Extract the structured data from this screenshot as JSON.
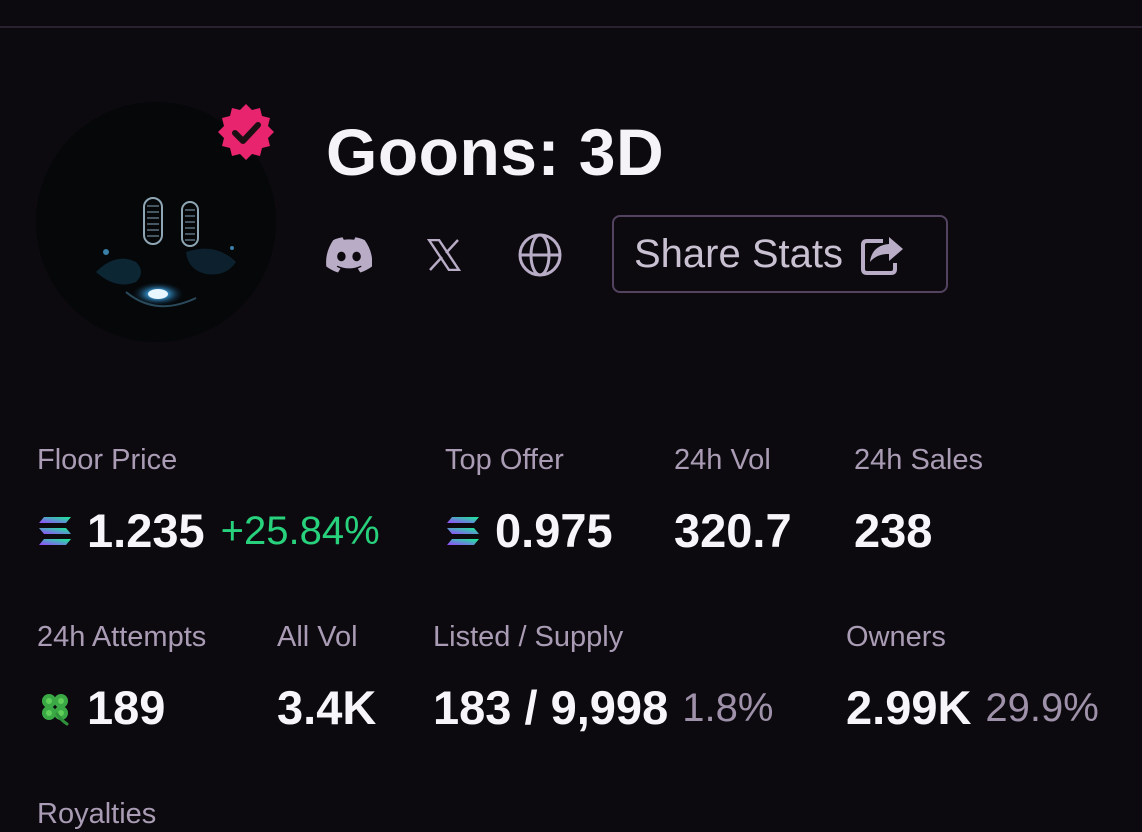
{
  "collection": {
    "name": "Goons: 3D",
    "verified": true
  },
  "links": {
    "discord_icon": "discord-icon",
    "x_icon": "x-icon",
    "website_icon": "globe-icon"
  },
  "share": {
    "label": "Share Stats",
    "icon": "share-icon"
  },
  "stats": {
    "floor_price": {
      "label": "Floor Price",
      "value": "1.235",
      "change": "+25.84%"
    },
    "top_offer": {
      "label": "Top Offer",
      "value": "0.975"
    },
    "vol_24h": {
      "label": "24h Vol",
      "value": "320.7"
    },
    "sales_24h": {
      "label": "24h Sales",
      "value": "238"
    },
    "attempts_24h": {
      "label": "24h Attempts",
      "value": "189"
    },
    "all_vol": {
      "label": "All Vol",
      "value": "3.4K"
    },
    "listed_supply": {
      "label": "Listed / Supply",
      "value": "183 / 9,998",
      "percent": "1.8%"
    },
    "owners": {
      "label": "Owners",
      "value": "2.99K",
      "percent": "29.9%"
    },
    "royalties": {
      "label": "Royalties"
    }
  },
  "colors": {
    "background": "#0c0a0f",
    "verified_badge": "#e8246e",
    "positive_change": "#28d17c",
    "muted_label": "#a99cb4",
    "button_border": "#544360"
  }
}
